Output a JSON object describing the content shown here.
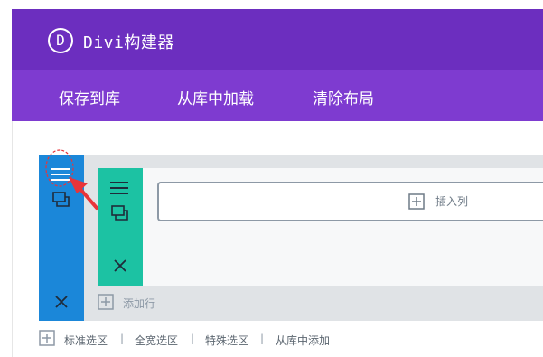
{
  "header": {
    "logo_letter": "D",
    "title": "Divi构建器"
  },
  "toolbar": {
    "save_label": "保存到库",
    "load_label": "从库中加载",
    "clear_label": "清除布局"
  },
  "builder": {
    "insert_column_label": "插入列",
    "add_row_label": "添加行"
  },
  "section_links": {
    "standard": "标准选区",
    "separator": "|",
    "fullwidth": "全宽选区",
    "specialty": "特殊选区",
    "from_library": "从库中添加"
  },
  "icons": {
    "section_settings": "hamburger-icon",
    "section_duplicate": "duplicate-icon",
    "section_delete": "close-icon",
    "row_settings": "hamburger-icon",
    "row_duplicate": "duplicate-icon",
    "row_delete": "close-icon",
    "add": "plus-box-icon"
  },
  "colors": {
    "header_bg": "#6c2ebf",
    "toolbar_bg": "#7e3bd0",
    "section_blue": "#1b87d9",
    "row_teal": "#1cc2a3",
    "annotation_red": "#e8343a"
  }
}
